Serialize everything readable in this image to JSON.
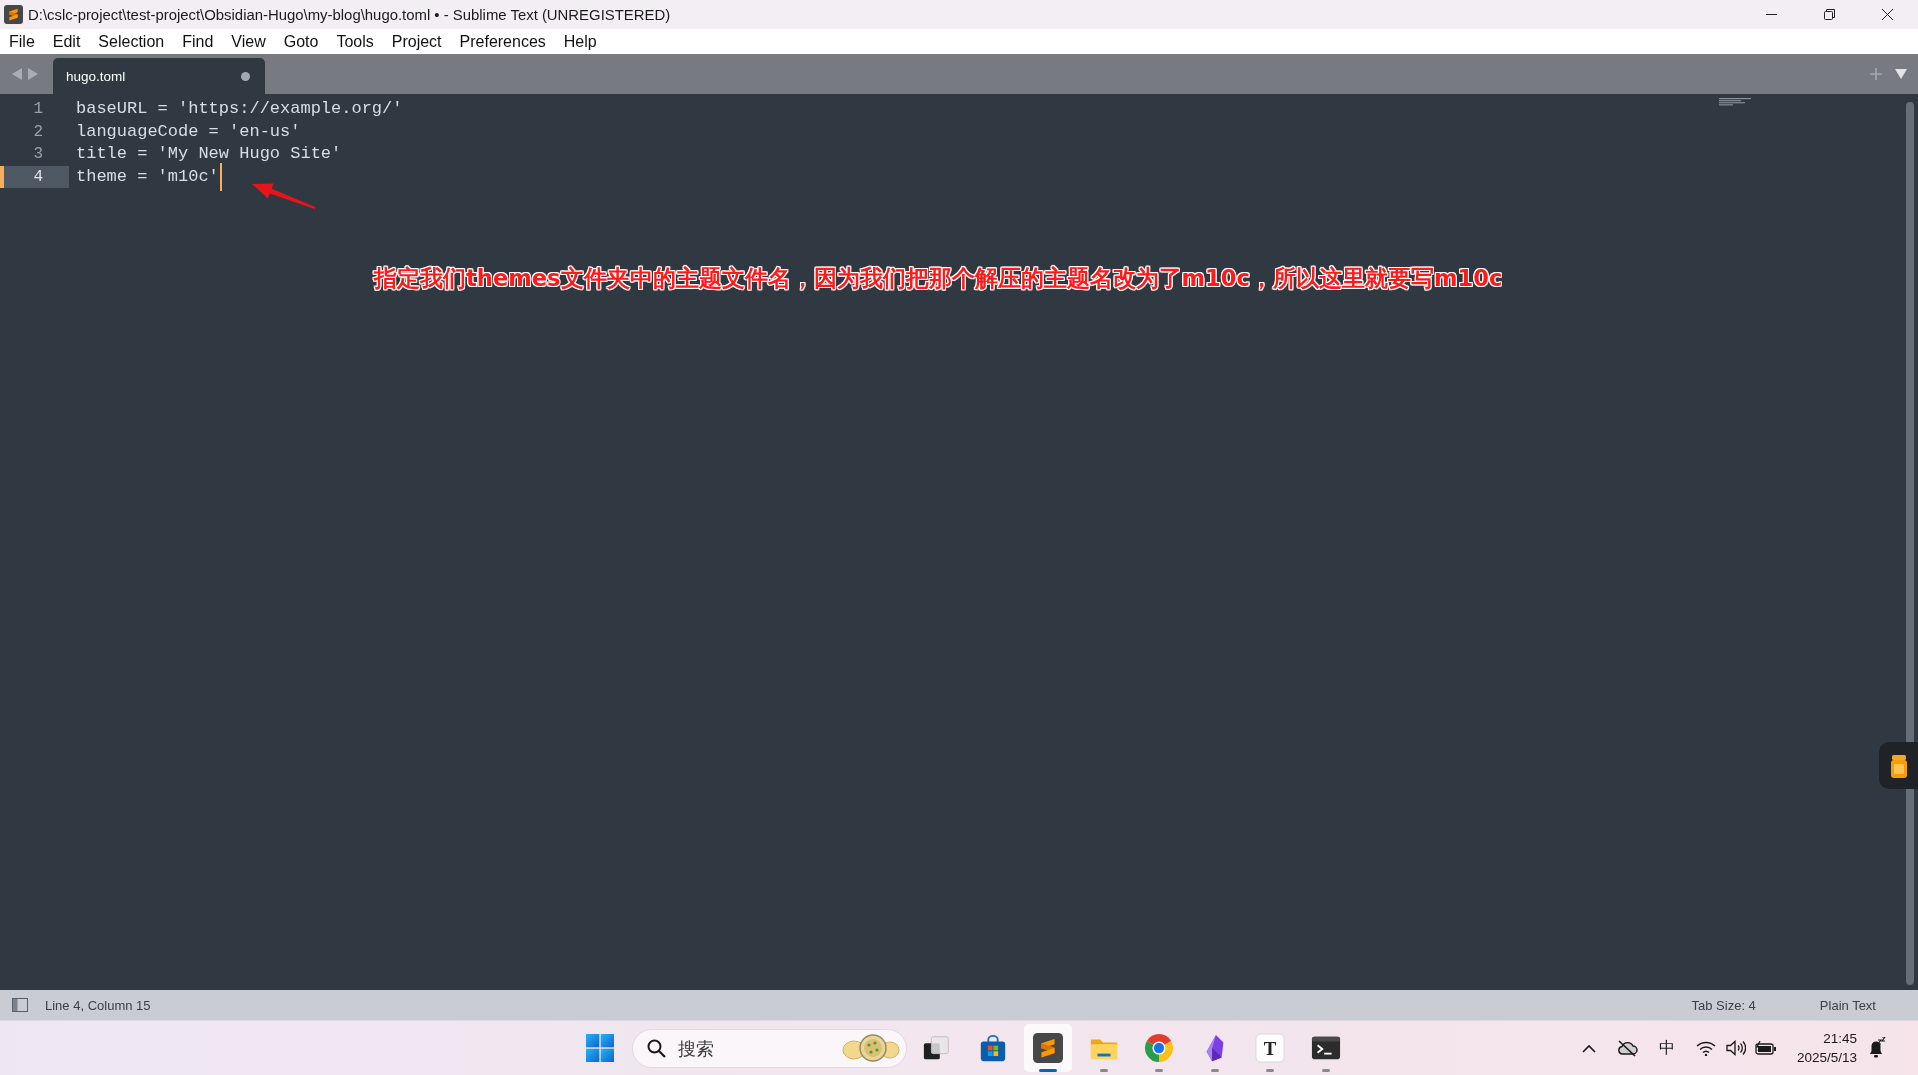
{
  "window": {
    "title": "D:\\cslc-project\\test-project\\Obsidian-Hugo\\my-blog\\hugo.toml • - Sublime Text (UNREGISTERED)"
  },
  "menu": [
    "File",
    "Edit",
    "Selection",
    "Find",
    "View",
    "Goto",
    "Tools",
    "Project",
    "Preferences",
    "Help"
  ],
  "tabs": [
    {
      "label": "hugo.toml",
      "selected": true,
      "modified": true
    }
  ],
  "editor": {
    "lines": [
      {
        "number": "1",
        "text": "baseURL = 'https://example.org/'",
        "current": false
      },
      {
        "number": "2",
        "text": "languageCode = 'en-us'",
        "current": false
      },
      {
        "number": "3",
        "text": "title = 'My New Hugo Site'",
        "current": false
      },
      {
        "number": "4",
        "text": "theme = 'm10c'",
        "current": true
      }
    ]
  },
  "annotation": {
    "text": "指定我们themes文件夹中的主题文件名，因为我们把那个解压的主题名改为了m10c，所以这里就要写m10c"
  },
  "status_bar": {
    "position": "Line 4, Column 15",
    "tab_size": "Tab Size: 4",
    "syntax": "Plain Text"
  },
  "taskbar": {
    "search": {
      "placeholder": "搜索"
    },
    "apps": [
      {
        "kind": "task-view",
        "running": false,
        "selected": false
      },
      {
        "kind": "store",
        "running": false,
        "selected": false
      },
      {
        "kind": "sublime",
        "running": true,
        "selected": true
      },
      {
        "kind": "files",
        "running": true,
        "selected": false
      },
      {
        "kind": "chrome",
        "running": true,
        "selected": false
      },
      {
        "kind": "obsidian",
        "running": true,
        "selected": false
      },
      {
        "kind": "typora",
        "label": "T",
        "running": true,
        "selected": false
      },
      {
        "kind": "terminal",
        "running": true,
        "selected": false
      }
    ],
    "tray": {
      "ime": "中",
      "time": "21:45",
      "date": "2025/5/13"
    }
  }
}
